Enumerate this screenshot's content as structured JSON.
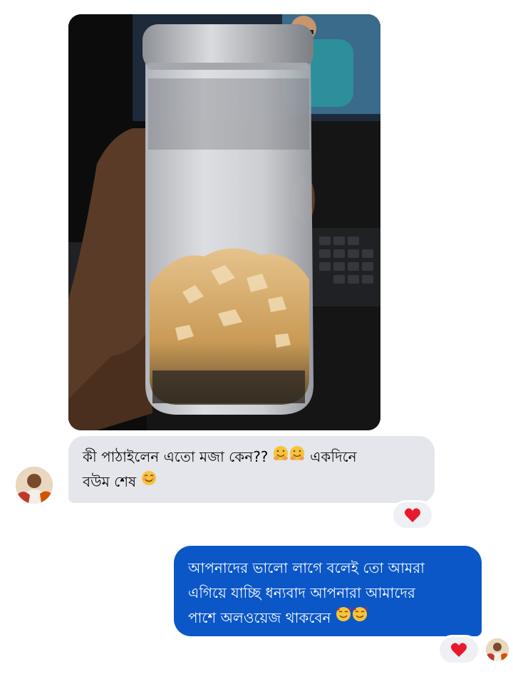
{
  "conversation": {
    "incoming_message": {
      "line1": "কী পাঠাইলেন এতো মজা কেন??",
      "line1_tail": "একদিনে",
      "line2": "বউম শেষ",
      "reaction": "heart"
    },
    "outgoing_message": {
      "line1": "আপনাদের ভালো লাগে বলেই তো আমরা",
      "line2": "এগিয়ে যাচ্ছি  ধন্যবাদ আপনারা আমাদের",
      "line3": "পাশে অলওয়েজ থাকবেন",
      "reaction": "heart"
    }
  },
  "icons": {
    "reaction": "heart-icon",
    "emoji_hug": "hugging-face-emoji",
    "emoji_smile": "smiling-face-emoji",
    "emoji_hearts": "smiling-face-with-hearts-emoji"
  },
  "colors": {
    "incoming_bubble": "#e4e6eb",
    "outgoing_bubble": "#0b57c7",
    "heart": "#e8192c"
  }
}
